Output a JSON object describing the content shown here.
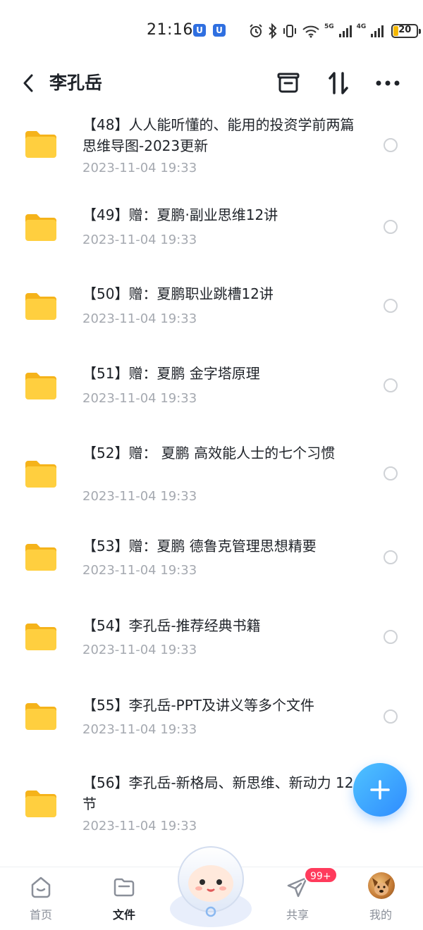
{
  "status_bar": {
    "time": "21:16",
    "app_badge_1": "U",
    "app_badge_2": "U",
    "network_1": "5G",
    "network_2": "4G",
    "battery_percent": "20",
    "battery_level": 0.2
  },
  "header": {
    "title": "李孔岳",
    "icons": [
      "back-icon",
      "select-icon",
      "sort-icon",
      "more-icon"
    ]
  },
  "files": [
    {
      "name": "【48】人人能听懂的、能用的投资学前两篇 思维导图-2023更新",
      "date": "2023-11-04  19:33"
    },
    {
      "name": "【49】赠：夏鹏·副业思维12讲",
      "date": "2023-11-04  19:33"
    },
    {
      "name": "【50】赠：夏鹏职业跳槽12讲",
      "date": "2023-11-04  19:33"
    },
    {
      "name": "【51】赠：夏鹏 金字塔原理",
      "date": "2023-11-04  19:33"
    },
    {
      "name": "【52】赠：  夏鹏 高效能人士的七个习惯",
      "date": "2023-11-04  19:33"
    },
    {
      "name": "【53】赠：夏鹏 德鲁克管理思想精要",
      "date": "2023-11-04  19:33"
    },
    {
      "name": "【54】李孔岳-推荐经典书籍",
      "date": "2023-11-04  19:33"
    },
    {
      "name": "【55】李孔岳-PPT及讲义等多个文件",
      "date": "2023-11-04  19:33"
    },
    {
      "name": "【56】李孔岳-新格局、新思维、新动力 12节",
      "date": "2023-11-04  19:33"
    }
  ],
  "nav": {
    "home": "首页",
    "files": "文件",
    "share": "共享",
    "share_badge": "99+",
    "mine": "我的"
  },
  "colors": {
    "accent": "#2f8cff",
    "folder": "#ffc93c",
    "badge": "#ff3b5c"
  }
}
